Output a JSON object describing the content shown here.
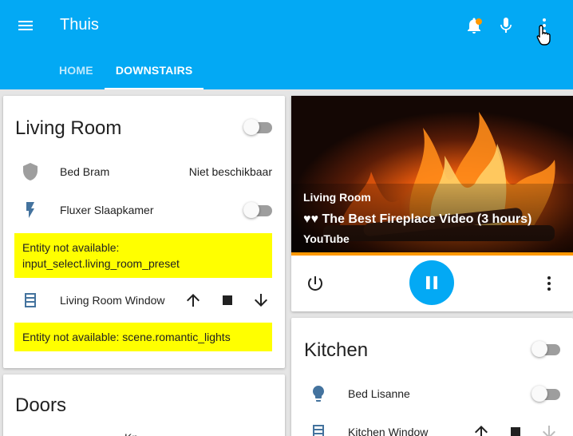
{
  "header": {
    "title": "Thuis"
  },
  "tabs": [
    {
      "label": "HOME",
      "active": false
    },
    {
      "label": "DOWNSTAIRS",
      "active": true
    }
  ],
  "living_room": {
    "title": "Living Room",
    "toggle_on": false,
    "rows": {
      "bed_bram": {
        "name": "Bed Bram",
        "state": "Niet beschikbaar",
        "icon": "shield-icon"
      },
      "fluxer": {
        "name": "Fluxer Slaapkamer",
        "toggle_on": false,
        "icon": "flash-icon"
      },
      "window": {
        "name": "Living Room Window",
        "icon": "window-shutter-icon"
      }
    },
    "warnings": {
      "preset": "Entity not available: input_select.living_room_preset",
      "scene": "Entity not available: scene.romantic_lights"
    }
  },
  "doors": {
    "title": "Doors",
    "partial_text": "Kn"
  },
  "media_player": {
    "context": "Living Room",
    "title": "♥♥ The Best Fireplace Video (3 hours)",
    "app": "YouTube",
    "state": "playing",
    "accent_color": "#ff9800"
  },
  "kitchen": {
    "title": "Kitchen",
    "toggle_on": false,
    "rows": {
      "bed_lisanne": {
        "name": "Bed Lisanne",
        "toggle_on": false,
        "icon": "lightbulb-icon"
      },
      "window": {
        "name": "Kitchen Window",
        "icon": "window-shutter-icon"
      }
    }
  },
  "colors": {
    "primary": "#03a9f4",
    "warning_bg": "#ffff00",
    "icon_blue": "#44739e",
    "notification_dot": "#ff9800"
  }
}
